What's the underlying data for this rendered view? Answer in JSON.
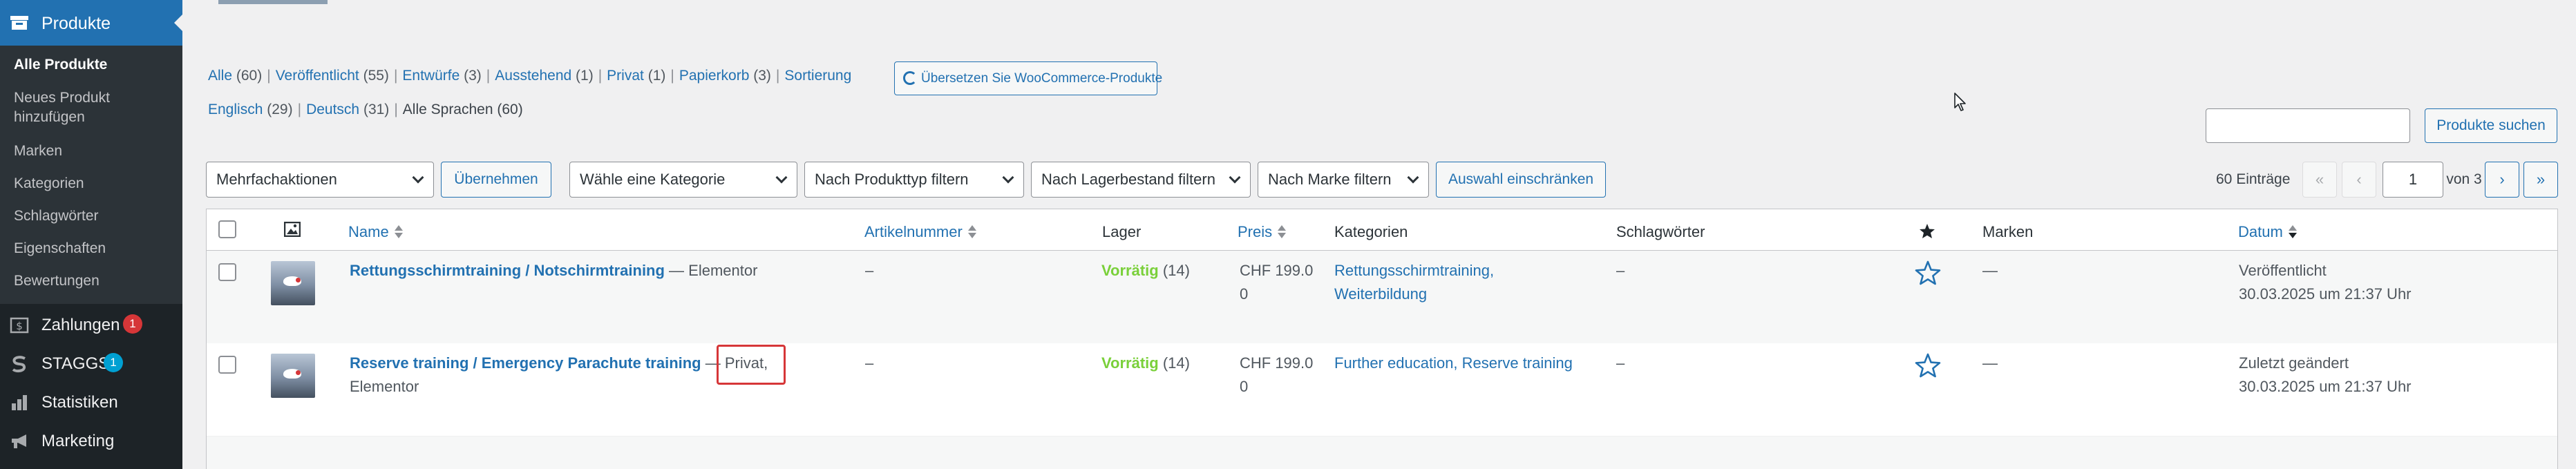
{
  "sidebar": {
    "active": {
      "label": "Produkte"
    },
    "submenu": [
      {
        "label": "Alle Produkte"
      },
      {
        "label": "Neues Produkt hinzufügen"
      },
      {
        "label": "Marken"
      },
      {
        "label": "Kategorien"
      },
      {
        "label": "Schlagwörter"
      },
      {
        "label": "Eigenschaften"
      },
      {
        "label": "Bewertungen"
      }
    ],
    "items": [
      {
        "label": "Zahlungen",
        "badge": "1",
        "icon": "payments-icon",
        "badge_color": "#d63638"
      },
      {
        "label": "STAGGS",
        "badge": "1",
        "icon": "staggs-icon",
        "badge_color": "#00a0d2"
      },
      {
        "label": "Statistiken",
        "icon": "bar-chart-icon"
      },
      {
        "label": "Marketing",
        "icon": "megaphone-icon"
      }
    ]
  },
  "status_filters": [
    {
      "label": "Alle",
      "count": "(60)"
    },
    {
      "label": "Veröffentlicht",
      "count": "(55)"
    },
    {
      "label": "Entwürfe",
      "count": "(3)"
    },
    {
      "label": "Ausstehend",
      "count": "(1)"
    },
    {
      "label": "Privat",
      "count": "(1)"
    },
    {
      "label": "Papierkorb",
      "count": "(3)"
    },
    {
      "label": "Sortierung",
      "count": ""
    }
  ],
  "translate_button": "Übersetzen Sie WooCommerce-Produkte",
  "language_filters": [
    {
      "label": "Englisch",
      "count": "(29)"
    },
    {
      "label": "Deutsch",
      "count": "(31)"
    },
    {
      "label": "Alle Sprachen (60)",
      "count": ""
    }
  ],
  "search": {
    "value": "",
    "button": "Produkte suchen"
  },
  "tablenav": {
    "bulk_action": "Mehrfachaktionen",
    "apply": "Übernehmen",
    "category_filter": "Wähle eine Kategorie",
    "type_filter": "Nach Produkttyp filtern",
    "stock_filter": "Nach Lagerbestand filtern",
    "brand_filter": "Nach Marke filtern",
    "filter_button": "Auswahl einschränken",
    "items_count": "60 Einträge",
    "first": "«",
    "prev": "‹",
    "current_page": "1",
    "page_of": "von 3",
    "next": "›",
    "last": "»"
  },
  "columns": {
    "name": "Name",
    "sku": "Artikelnummer",
    "stock": "Lager",
    "price": "Preis",
    "categories": "Kategorien",
    "tags": "Schlagwörter",
    "brands": "Marken",
    "date": "Datum"
  },
  "rows": [
    {
      "name": "Rettungsschirmtraining / Notschirmtraining",
      "state_prefix": " — ",
      "state_highlight": "",
      "state_rest": "Elementor",
      "sku": "–",
      "stock_status": "Vorrätig",
      "stock_count": "(14)",
      "price_line1": "CHF 199.0",
      "price_line2": "0",
      "categories_line1": "Rettungsschirmtraining,",
      "categories_line2": "Weiterbildung",
      "tags": "–",
      "brands": "—",
      "date_status": "Veröffentlicht",
      "date_value": "30.03.2025 um 21:37 Uhr"
    },
    {
      "name": "Reserve training / Emergency Parachute training",
      "state_prefix": " — ",
      "state_highlight": "Privat,",
      "state_rest": "Elementor",
      "sku": "–",
      "stock_status": "Vorrätig",
      "stock_count": "(14)",
      "price_line1": "CHF 199.0",
      "price_line2": "0",
      "categories_line1": "Further education, Reserve training",
      "categories_line2": "",
      "tags": "–",
      "brands": "—",
      "date_status": "Zuletzt geändert",
      "date_value": "30.03.2025 um 21:37 Uhr"
    }
  ],
  "colors": {
    "accent": "#2271b1",
    "sidebar": "#1d2327",
    "in_stock": "#7ad03a",
    "highlight": "#d63638"
  }
}
